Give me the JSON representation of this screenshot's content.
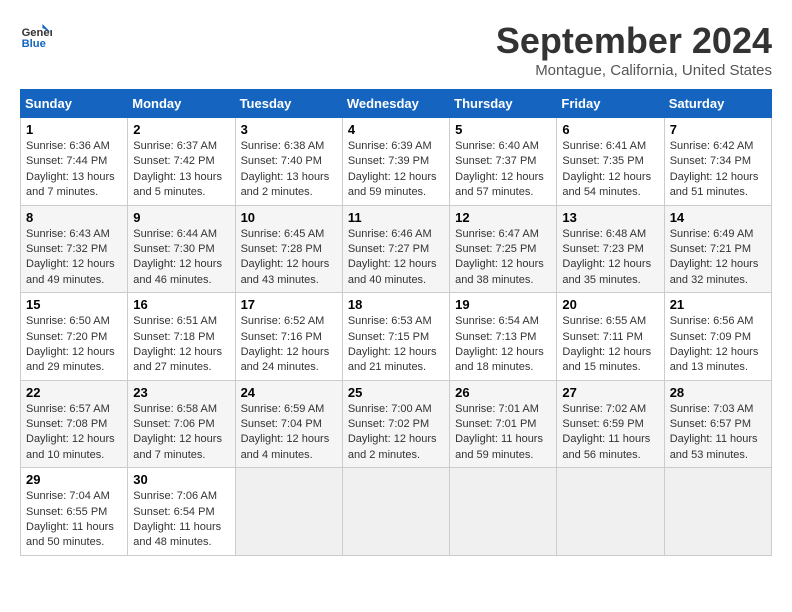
{
  "logo": {
    "line1": "General",
    "line2": "Blue"
  },
  "title": "September 2024",
  "location": "Montague, California, United States",
  "days_of_week": [
    "Sunday",
    "Monday",
    "Tuesday",
    "Wednesday",
    "Thursday",
    "Friday",
    "Saturday"
  ],
  "weeks": [
    [
      {
        "day": "1",
        "sunrise": "6:36 AM",
        "sunset": "7:44 PM",
        "daylight": "13 hours and 7 minutes."
      },
      {
        "day": "2",
        "sunrise": "6:37 AM",
        "sunset": "7:42 PM",
        "daylight": "13 hours and 5 minutes."
      },
      {
        "day": "3",
        "sunrise": "6:38 AM",
        "sunset": "7:40 PM",
        "daylight": "13 hours and 2 minutes."
      },
      {
        "day": "4",
        "sunrise": "6:39 AM",
        "sunset": "7:39 PM",
        "daylight": "12 hours and 59 minutes."
      },
      {
        "day": "5",
        "sunrise": "6:40 AM",
        "sunset": "7:37 PM",
        "daylight": "12 hours and 57 minutes."
      },
      {
        "day": "6",
        "sunrise": "6:41 AM",
        "sunset": "7:35 PM",
        "daylight": "12 hours and 54 minutes."
      },
      {
        "day": "7",
        "sunrise": "6:42 AM",
        "sunset": "7:34 PM",
        "daylight": "12 hours and 51 minutes."
      }
    ],
    [
      {
        "day": "8",
        "sunrise": "6:43 AM",
        "sunset": "7:32 PM",
        "daylight": "12 hours and 49 minutes."
      },
      {
        "day": "9",
        "sunrise": "6:44 AM",
        "sunset": "7:30 PM",
        "daylight": "12 hours and 46 minutes."
      },
      {
        "day": "10",
        "sunrise": "6:45 AM",
        "sunset": "7:28 PM",
        "daylight": "12 hours and 43 minutes."
      },
      {
        "day": "11",
        "sunrise": "6:46 AM",
        "sunset": "7:27 PM",
        "daylight": "12 hours and 40 minutes."
      },
      {
        "day": "12",
        "sunrise": "6:47 AM",
        "sunset": "7:25 PM",
        "daylight": "12 hours and 38 minutes."
      },
      {
        "day": "13",
        "sunrise": "6:48 AM",
        "sunset": "7:23 PM",
        "daylight": "12 hours and 35 minutes."
      },
      {
        "day": "14",
        "sunrise": "6:49 AM",
        "sunset": "7:21 PM",
        "daylight": "12 hours and 32 minutes."
      }
    ],
    [
      {
        "day": "15",
        "sunrise": "6:50 AM",
        "sunset": "7:20 PM",
        "daylight": "12 hours and 29 minutes."
      },
      {
        "day": "16",
        "sunrise": "6:51 AM",
        "sunset": "7:18 PM",
        "daylight": "12 hours and 27 minutes."
      },
      {
        "day": "17",
        "sunrise": "6:52 AM",
        "sunset": "7:16 PM",
        "daylight": "12 hours and 24 minutes."
      },
      {
        "day": "18",
        "sunrise": "6:53 AM",
        "sunset": "7:15 PM",
        "daylight": "12 hours and 21 minutes."
      },
      {
        "day": "19",
        "sunrise": "6:54 AM",
        "sunset": "7:13 PM",
        "daylight": "12 hours and 18 minutes."
      },
      {
        "day": "20",
        "sunrise": "6:55 AM",
        "sunset": "7:11 PM",
        "daylight": "12 hours and 15 minutes."
      },
      {
        "day": "21",
        "sunrise": "6:56 AM",
        "sunset": "7:09 PM",
        "daylight": "12 hours and 13 minutes."
      }
    ],
    [
      {
        "day": "22",
        "sunrise": "6:57 AM",
        "sunset": "7:08 PM",
        "daylight": "12 hours and 10 minutes."
      },
      {
        "day": "23",
        "sunrise": "6:58 AM",
        "sunset": "7:06 PM",
        "daylight": "12 hours and 7 minutes."
      },
      {
        "day": "24",
        "sunrise": "6:59 AM",
        "sunset": "7:04 PM",
        "daylight": "12 hours and 4 minutes."
      },
      {
        "day": "25",
        "sunrise": "7:00 AM",
        "sunset": "7:02 PM",
        "daylight": "12 hours and 2 minutes."
      },
      {
        "day": "26",
        "sunrise": "7:01 AM",
        "sunset": "7:01 PM",
        "daylight": "11 hours and 59 minutes."
      },
      {
        "day": "27",
        "sunrise": "7:02 AM",
        "sunset": "6:59 PM",
        "daylight": "11 hours and 56 minutes."
      },
      {
        "day": "28",
        "sunrise": "7:03 AM",
        "sunset": "6:57 PM",
        "daylight": "11 hours and 53 minutes."
      }
    ],
    [
      {
        "day": "29",
        "sunrise": "7:04 AM",
        "sunset": "6:55 PM",
        "daylight": "11 hours and 50 minutes."
      },
      {
        "day": "30",
        "sunrise": "7:06 AM",
        "sunset": "6:54 PM",
        "daylight": "11 hours and 48 minutes."
      },
      null,
      null,
      null,
      null,
      null
    ]
  ]
}
